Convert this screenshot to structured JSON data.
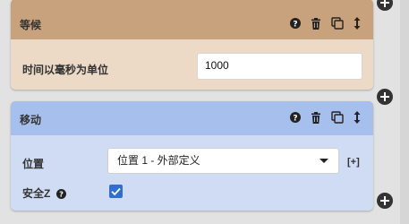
{
  "wait_panel": {
    "title": "等候",
    "field_label": "时间以毫秒为单位",
    "field_value": "1000",
    "header_color": "#c8a27c",
    "body_color": "#ecd9c6"
  },
  "move_panel": {
    "title": "移动",
    "position_label": "位置",
    "position_selected": "位置 1 - 外部定义",
    "add_link": "[+]",
    "safe_z_label": "安全Z",
    "safe_z_checked": true,
    "header_color": "#a6bfec",
    "body_color": "#cfdcf4"
  },
  "icons": [
    "help-icon",
    "trash-icon",
    "copy-icon",
    "drag-icon",
    "add-block-icon",
    "checkmark-icon"
  ]
}
